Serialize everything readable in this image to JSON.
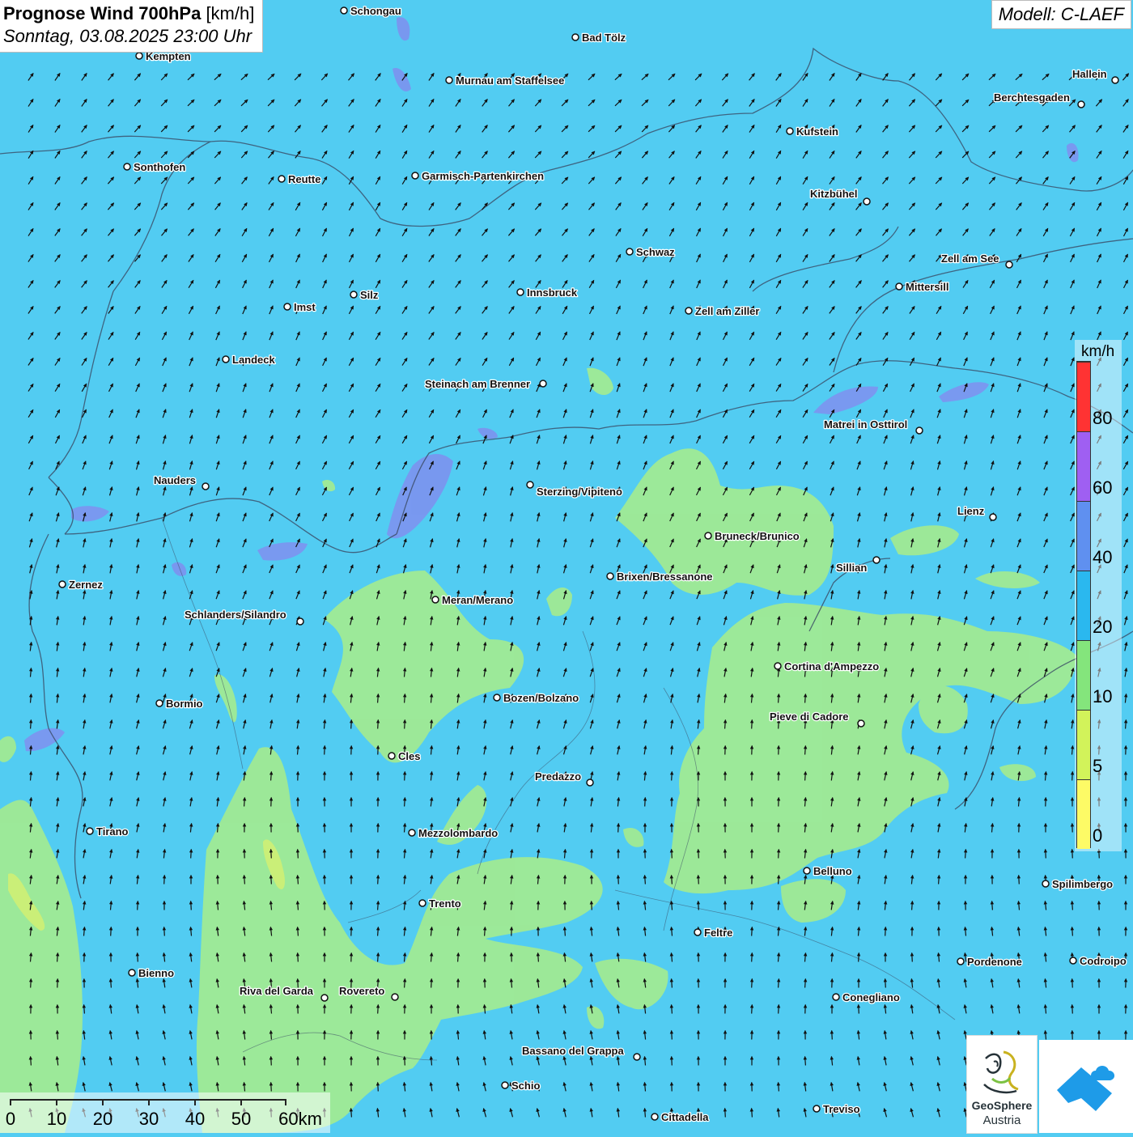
{
  "header": {
    "title_bold": "Prognose Wind 700hPa",
    "title_unit": "[km/h]",
    "datetime": "Sonntag, 03.08.2025 23:00 Uhr"
  },
  "model": {
    "label": "Modell: C-LAEF"
  },
  "legend": {
    "unit": "km/h",
    "ticks": [
      "80",
      "60",
      "40",
      "20",
      "10",
      "5",
      "0"
    ],
    "colors": [
      "#ff3333",
      "#9f5ff2",
      "#5f90f0",
      "#2ab8ef",
      "#84e57c",
      "#d2f35a",
      "#fdfb66"
    ]
  },
  "scale_bar": {
    "labels": [
      "0",
      "10",
      "20",
      "30",
      "40",
      "50",
      "60km"
    ]
  },
  "colors": {
    "water_speed_band": "#52ccf2",
    "low_speed_band": "#a0ea94",
    "high_speed_band": "#7d93ef"
  },
  "cities": [
    {
      "name": "Schongau"
    },
    {
      "name": "Bad Tölz"
    },
    {
      "name": "Kempten"
    },
    {
      "name": "Murnau am Staffelsee"
    },
    {
      "name": "Hallein"
    },
    {
      "name": "Berchtesgaden"
    },
    {
      "name": "Kufstein"
    },
    {
      "name": "Sonthofen"
    },
    {
      "name": "Reutte"
    },
    {
      "name": "Garmisch-Partenkirchen"
    },
    {
      "name": "Kitzbühel"
    },
    {
      "name": "Schwaz"
    },
    {
      "name": "Zell am See"
    },
    {
      "name": "Mittersill"
    },
    {
      "name": "Silz"
    },
    {
      "name": "Innsbruck"
    },
    {
      "name": "Imst"
    },
    {
      "name": "Zell am Ziller"
    },
    {
      "name": "Landeck"
    },
    {
      "name": "Steinach am Brenner"
    },
    {
      "name": "Matrei in Osttirol"
    },
    {
      "name": "Nauders"
    },
    {
      "name": "Sterzing/Vipiteno"
    },
    {
      "name": "Lienz"
    },
    {
      "name": "Bruneck/Brunico"
    },
    {
      "name": "Sillian"
    },
    {
      "name": "Brixen/Bressanone"
    },
    {
      "name": "Zernez"
    },
    {
      "name": "Meran/Merano"
    },
    {
      "name": "Schlanders/Silandro"
    },
    {
      "name": "Cortina d'Ampezzo"
    },
    {
      "name": "Bozen/Bolzano"
    },
    {
      "name": "Bormio"
    },
    {
      "name": "Pieve di Cadore"
    },
    {
      "name": "Cles"
    },
    {
      "name": "Predazzo"
    },
    {
      "name": "Tirano"
    },
    {
      "name": "Mezzolombardo"
    },
    {
      "name": "Belluno"
    },
    {
      "name": "Spilimbergo"
    },
    {
      "name": "Trento"
    },
    {
      "name": "Feltre"
    },
    {
      "name": "Bienno"
    },
    {
      "name": "Pordenone"
    },
    {
      "name": "Codroipo"
    },
    {
      "name": "Riva del Garda"
    },
    {
      "name": "Rovereto"
    },
    {
      "name": "Conegliano"
    },
    {
      "name": "Bassano del Grappa"
    },
    {
      "name": "Schio"
    },
    {
      "name": "Treviso"
    },
    {
      "name": "Cittadella"
    }
  ],
  "logos": {
    "geosphere_name": "GeoSphere",
    "geosphere_sub": "Austria"
  }
}
